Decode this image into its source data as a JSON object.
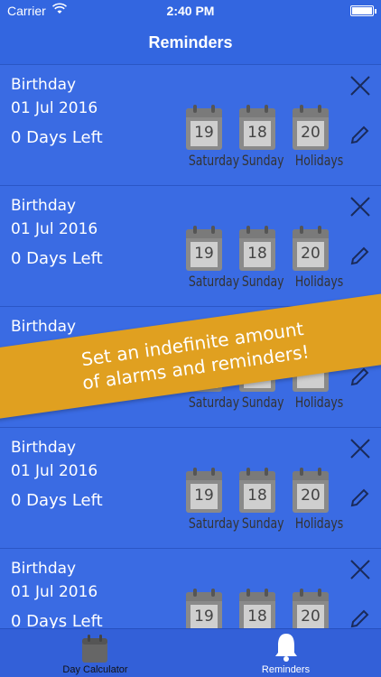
{
  "status_bar": {
    "carrier": "Carrier",
    "time": "2:40 PM",
    "wifi_icon": "wifi-icon",
    "battery_icon": "battery-icon"
  },
  "nav": {
    "title": "Reminders"
  },
  "reminders": [
    {
      "name": "Birthday",
      "date": "01 Jul 2016",
      "days_left": "0 Days Left",
      "saturday_count": "19",
      "sunday_count": "18",
      "holidays_count": "20"
    },
    {
      "name": "Birthday",
      "date": "01 Jul 2016",
      "days_left": "0 Days Left",
      "saturday_count": "19",
      "sunday_count": "18",
      "holidays_count": "20"
    },
    {
      "name": "Birthday",
      "date": "",
      "days_left": "",
      "saturday_count": "",
      "sunday_count": "",
      "holidays_count": ""
    },
    {
      "name": "Birthday",
      "date": "01 Jul 2016",
      "days_left": "0 Days Left",
      "saturday_count": "19",
      "sunday_count": "18",
      "holidays_count": "20"
    },
    {
      "name": "Birthday",
      "date": "01 Jul 2016",
      "days_left": "0 Days Left",
      "saturday_count": "19",
      "sunday_count": "18",
      "holidays_count": "20"
    }
  ],
  "labels": {
    "saturday": "Saturday",
    "sunday": "Sunday",
    "holidays": "Holidays"
  },
  "banner": {
    "line1": "Set an indefinite amount",
    "line2": "of alarms and reminders!"
  },
  "tabs": {
    "calculator": "Day Calculator",
    "reminders": "Reminders"
  },
  "colors": {
    "background": "#3a6be3",
    "banner": "#e0a020",
    "tab_bar": "#3360d8"
  }
}
